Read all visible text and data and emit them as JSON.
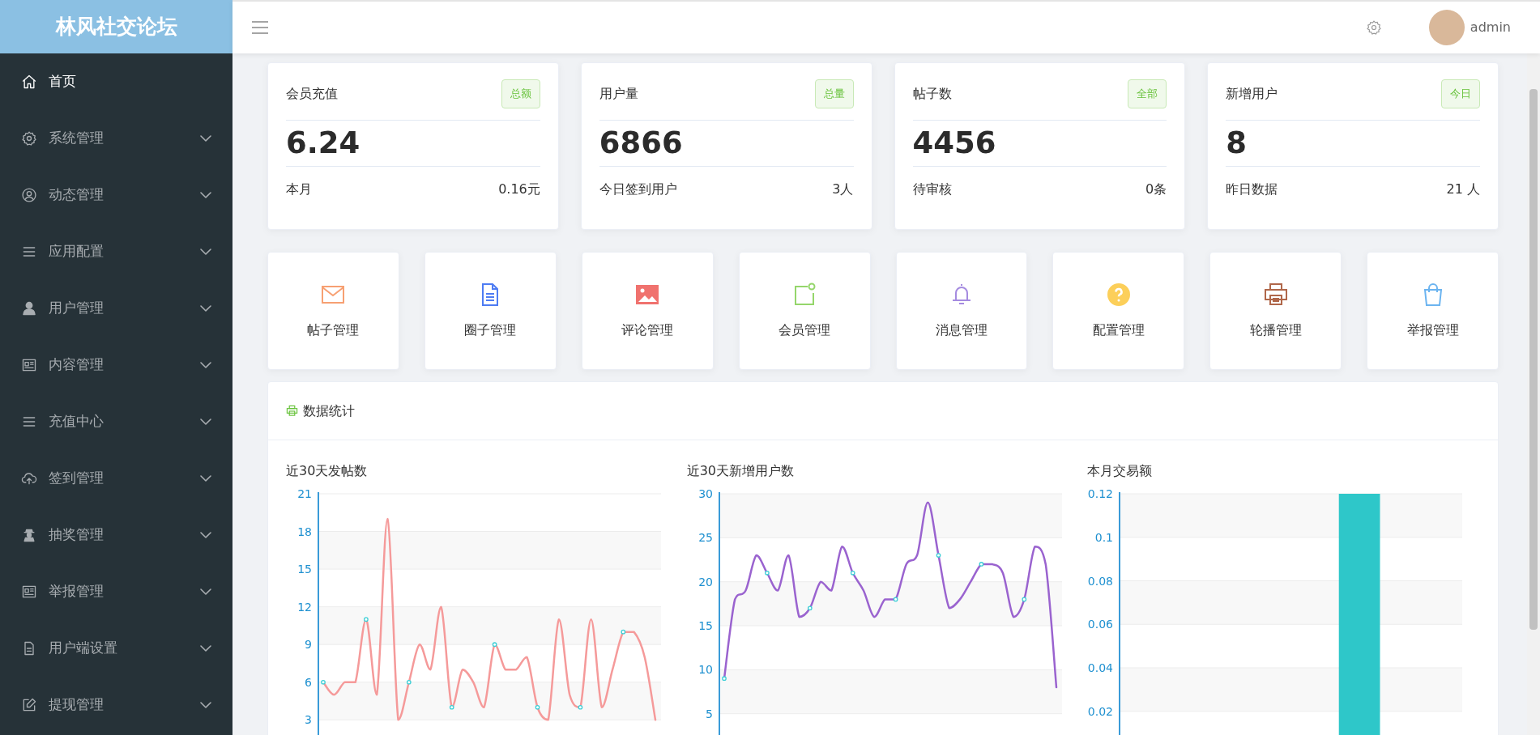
{
  "app": {
    "title": "林风社交论坛"
  },
  "sidebar": {
    "items": [
      {
        "label": "首页",
        "selected": true,
        "expandable": false
      },
      {
        "label": "系统管理",
        "selected": false,
        "expandable": true
      },
      {
        "label": "动态管理",
        "selected": false,
        "expandable": true
      },
      {
        "label": "应用配置",
        "selected": false,
        "expandable": true
      },
      {
        "label": "用户管理",
        "selected": false,
        "expandable": true
      },
      {
        "label": "内容管理",
        "selected": false,
        "expandable": true
      },
      {
        "label": "充值中心",
        "selected": false,
        "expandable": true
      },
      {
        "label": "签到管理",
        "selected": false,
        "expandable": true
      },
      {
        "label": "抽奖管理",
        "selected": false,
        "expandable": true
      },
      {
        "label": "举报管理",
        "selected": false,
        "expandable": true
      },
      {
        "label": "用户端设置",
        "selected": false,
        "expandable": true
      },
      {
        "label": "提现管理",
        "selected": false,
        "expandable": true
      }
    ]
  },
  "header": {
    "user": "admin"
  },
  "stats": [
    {
      "title": "会员充值",
      "tag": "总额",
      "value": "6.24",
      "footer_label": "本月",
      "footer_value": "0.16元"
    },
    {
      "title": "用户量",
      "tag": "总量",
      "value": "6866",
      "footer_label": "今日签到用户",
      "footer_value": "3人"
    },
    {
      "title": "帖子数",
      "tag": "全部",
      "value": "4456",
      "footer_label": "待审核",
      "footer_value": "0条"
    },
    {
      "title": "新增用户",
      "tag": "今日",
      "value": "8",
      "footer_label": "昨日数据",
      "footer_value": "21 人"
    }
  ],
  "shortcuts": [
    {
      "label": "帖子管理"
    },
    {
      "label": "圈子管理"
    },
    {
      "label": "评论管理"
    },
    {
      "label": "会员管理"
    },
    {
      "label": "消息管理"
    },
    {
      "label": "配置管理"
    },
    {
      "label": "轮播管理"
    },
    {
      "label": "举报管理"
    }
  ],
  "statistics": {
    "title": "数据统计",
    "charts": [
      {
        "title": "近30天发帖数",
        "chart_data": {
          "type": "line",
          "grid": true,
          "ylim": [
            1.6,
            21
          ],
          "yticks": [
            3,
            6,
            9,
            12,
            15,
            18,
            21
          ],
          "series": [
            {
              "color": "#f59a9a",
              "values": [
                6,
                5,
                6,
                6,
                11,
                5,
                19,
                3,
                6,
                9,
                7,
                12,
                4,
                7,
                6,
                4,
                9,
                7,
                7,
                8,
                4,
                3,
                11,
                5,
                4,
                11,
                4,
                7,
                10,
                10,
                8,
                3
              ]
            }
          ]
        }
      },
      {
        "title": "近30天新增用户数",
        "chart_data": {
          "type": "line",
          "grid": true,
          "ylim": [
            2.3,
            30
          ],
          "yticks": [
            5,
            10,
            15,
            20,
            25,
            30
          ],
          "series": [
            {
              "color": "#9a63cf",
              "values": [
                9,
                18,
                19,
                23,
                21,
                19,
                23,
                16,
                17,
                20,
                19,
                24,
                21,
                19,
                16,
                18,
                18,
                22,
                23,
                29,
                23,
                17,
                18,
                20,
                22,
                22,
                21,
                16,
                18,
                24,
                22,
                8
              ]
            }
          ]
        }
      },
      {
        "title": "本月交易额",
        "chart_data": {
          "type": "bar",
          "grid": true,
          "ylim": [
            0.008,
            0.12
          ],
          "yticks": [
            0.02,
            0.04,
            0.06,
            0.08,
            0.1,
            0.12
          ],
          "series": [
            {
              "color": "#2ec7c9",
              "values": [
                null,
                null,
                null,
                0.12,
                null
              ]
            }
          ]
        }
      }
    ]
  }
}
